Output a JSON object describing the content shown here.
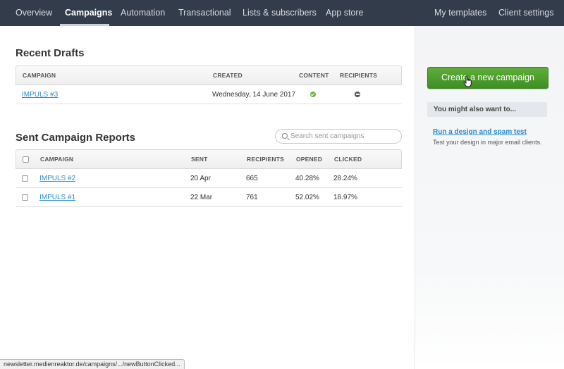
{
  "nav": {
    "left": [
      {
        "label": "Overview",
        "active": false
      },
      {
        "label": "Campaigns",
        "active": true
      },
      {
        "label": "Automation",
        "active": false
      },
      {
        "label": "Transactional",
        "active": false
      },
      {
        "label": "Lists & subscribers",
        "active": false
      },
      {
        "label": "App store",
        "active": false
      }
    ],
    "right": [
      {
        "label": "My templates"
      },
      {
        "label": "Client settings"
      }
    ]
  },
  "drafts": {
    "title": "Recent Drafts",
    "columns": [
      "CAMPAIGN",
      "CREATED",
      "CONTENT",
      "RECIPIENTS"
    ],
    "rows": [
      {
        "campaign": "IMPULS #3",
        "created": "Wednesday, 14 June 2017",
        "content_status": "check-icon",
        "recipients_status": "minus-icon"
      }
    ]
  },
  "sent": {
    "title": "Sent Campaign Reports",
    "search_placeholder": "Search sent campaigns",
    "columns": [
      "CAMPAIGN",
      "SENT",
      "RECIPIENTS",
      "OPENED",
      "CLICKED"
    ],
    "rows": [
      {
        "campaign": "IMPULS #2",
        "sent": "20 Apr",
        "recipients": "665",
        "opened": "40.28%",
        "clicked": "28.24%"
      },
      {
        "campaign": "IMPULS #1",
        "sent": "22 Mar",
        "recipients": "761",
        "opened": "52.02%",
        "clicked": "18.97%"
      }
    ]
  },
  "sidebar": {
    "create_button": "Create a new campaign",
    "might_title": "You might also want to...",
    "suggestion_link": "Run a design and spam test",
    "suggestion_desc": "Test your design in major email clients."
  },
  "status_bar": "newsletter.medienreaktor.de/campaigns/.../newButtonClicked...",
  "colors": {
    "nav_bg": "#333c4a",
    "link": "#2a8bc9",
    "create_button": "#4a9b2c",
    "check_green": "#6cb33f"
  }
}
